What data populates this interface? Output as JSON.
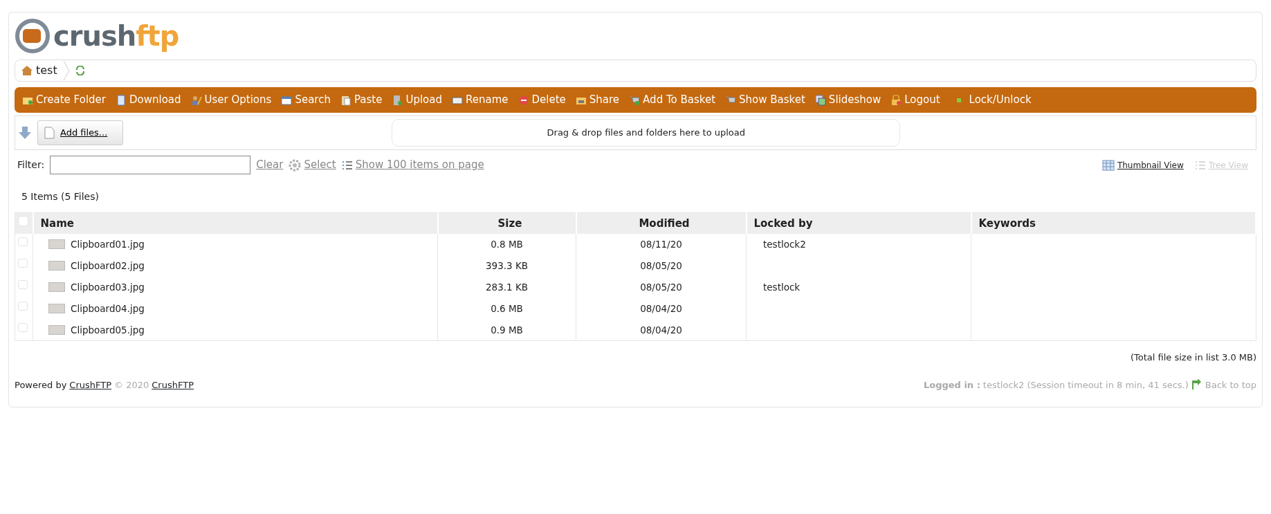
{
  "logo": {
    "part_1": "crush",
    "part_2": "ftp"
  },
  "breadcrumb": {
    "items": [
      "test"
    ]
  },
  "toolbar": [
    {
      "label": "Create Folder"
    },
    {
      "label": "Download"
    },
    {
      "label": "User Options"
    },
    {
      "label": "Search"
    },
    {
      "label": "Paste"
    },
    {
      "label": "Upload"
    },
    {
      "label": "Rename"
    },
    {
      "label": "Delete"
    },
    {
      "label": "Share"
    },
    {
      "label": "Add To Basket"
    },
    {
      "label": "Show Basket"
    },
    {
      "label": "Slideshow"
    },
    {
      "label": "Logout"
    },
    {
      "label": "Lock/Unlock"
    }
  ],
  "upload": {
    "add_button": "Add files...",
    "drop_hint": "Drag & drop files and folders here to upload"
  },
  "filter": {
    "label": "Filter:",
    "clear": "Clear",
    "select": "Select",
    "page_size": "Show 100 items on page"
  },
  "views": [
    {
      "label": "Thumbnail View",
      "disabled": false
    },
    {
      "label": "Tree View",
      "disabled": true
    }
  ],
  "summary": "5 Items (5 Files)",
  "table": {
    "select_all_checked": false,
    "columns": [
      "Name",
      "Size",
      "Modified",
      "Locked by",
      "Keywords"
    ],
    "rows": [
      {
        "checked": false,
        "name": "Clipboard01.jpg",
        "size": "0.8 MB",
        "modified": "08/11/20",
        "locked_by": "testlock2"
      },
      {
        "checked": false,
        "name": "Clipboard02.jpg",
        "size": "393.3 KB",
        "modified": "08/05/20"
      },
      {
        "checked": false,
        "name": "Clipboard03.jpg",
        "size": "283.1 KB",
        "modified": "08/05/20",
        "locked_by": "testlock"
      },
      {
        "checked": false,
        "name": "Clipboard04.jpg",
        "size": "0.6 MB",
        "modified": "08/04/20"
      },
      {
        "checked": false,
        "name": "Clipboard05.jpg",
        "size": "0.9 MB",
        "modified": "08/04/20"
      }
    ]
  },
  "total_size": "(Total file size in list 3.0 MB)",
  "footer": {
    "powered_by": "Powered by",
    "link_1": "CrushFTP",
    "copyright": "© 2020",
    "link_2": "CrushFTP",
    "logged_in_label": "Logged in :",
    "session": "testlock2 (Session timeout in 8 min, 41 secs.)",
    "back_to_top": "Back to top"
  }
}
